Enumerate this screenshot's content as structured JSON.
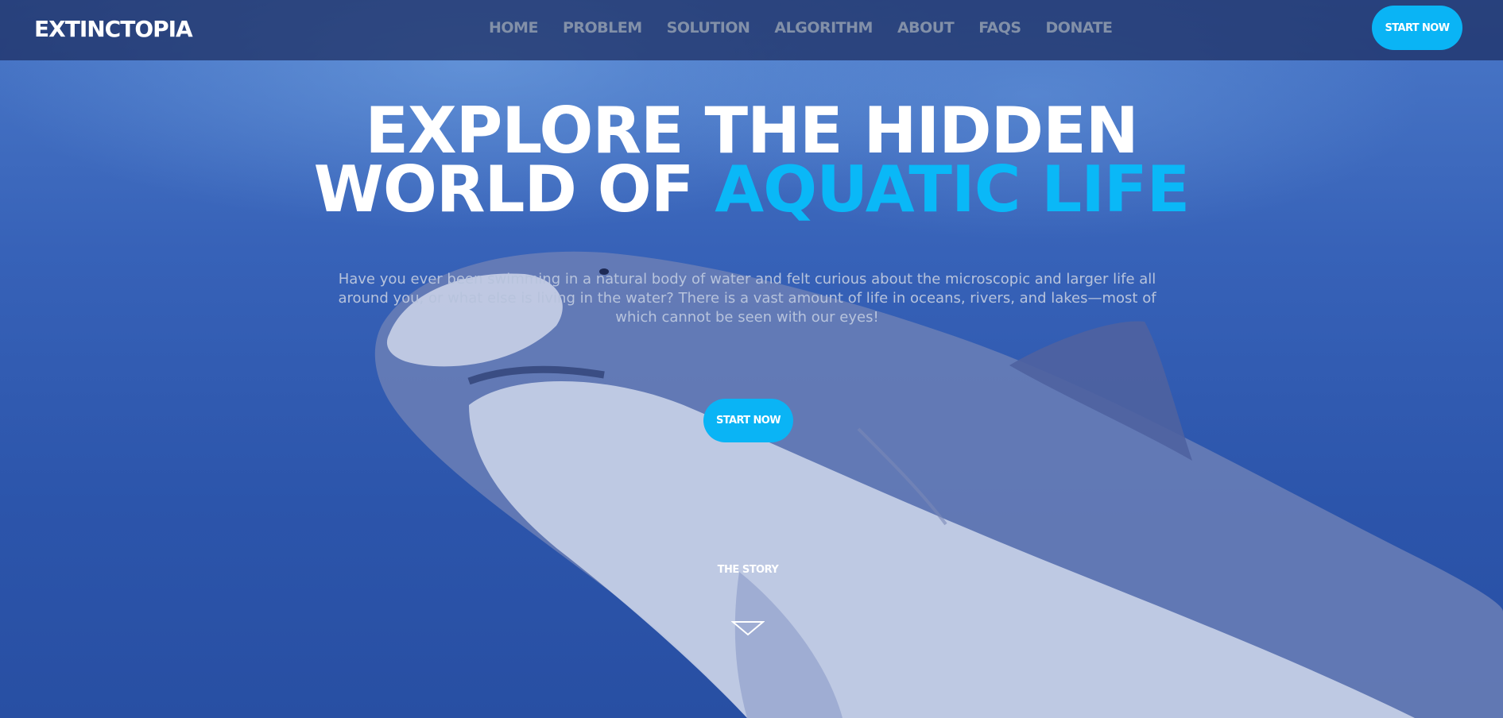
{
  "brand": {
    "logo_text": "EXTINCTOPIA"
  },
  "nav": {
    "items": [
      {
        "label": "HOME"
      },
      {
        "label": "PROBLEM"
      },
      {
        "label": "SOLUTION"
      },
      {
        "label": "ALGORITHM"
      },
      {
        "label": "ABOUT"
      },
      {
        "label": "FAQS"
      },
      {
        "label": "DONATE"
      }
    ],
    "cta_label": "START NOW"
  },
  "hero": {
    "headline_line1": "EXPLORE THE HIDDEN",
    "headline_line2_prefix": "WORLD OF ",
    "headline_line2_accent": "AQUATIC LIFE",
    "intro": "Have you ever been swimming in a natural body of water and felt curious about the microscopic and larger life all around you, or what else is living in the water? There is a vast amount of life in oceans, rivers, and lakes—most of which cannot be seen with our eyes!",
    "cta_label": "START NOW",
    "story_label": "THE STORY",
    "scroll_icon": "chevron-down-icon",
    "background_image": "shark-underwater-photo"
  },
  "colors": {
    "accent": "#0ab4f5",
    "nav_bar": "#1c2d5f",
    "nav_link": "#8290a8",
    "headline": "#ffffff",
    "body_text": "#b7c3dc"
  }
}
